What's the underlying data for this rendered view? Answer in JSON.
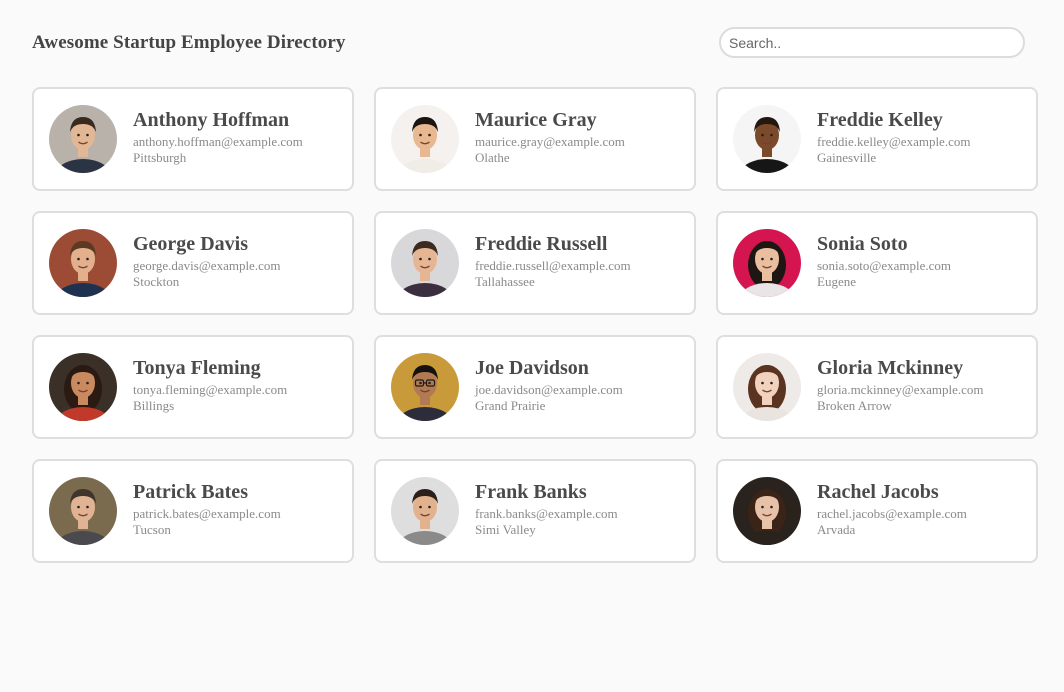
{
  "header": {
    "title": "Awesome Startup Employee Directory",
    "search_placeholder": "Search.."
  },
  "employees": [
    {
      "name": "Anthony Hoffman",
      "email": "anthony.hoffman@example.com",
      "city": "Pittsburgh",
      "photo_bg": "#b8b2ab",
      "skin": "#e2b795",
      "hair": "#3a2a1e",
      "shirt": "#2a3442"
    },
    {
      "name": "Maurice Gray",
      "email": "maurice.gray@example.com",
      "city": "Olathe",
      "photo_bg": "#f4f1ee",
      "skin": "#e8b890",
      "hair": "#1b1410",
      "shirt": "#f0ece6"
    },
    {
      "name": "Freddie Kelley",
      "email": "freddie.kelley@example.com",
      "city": "Gainesville",
      "photo_bg": "#f5f5f5",
      "skin": "#7a4a2a",
      "hair": "#231710",
      "shirt": "#161616"
    },
    {
      "name": "George Davis",
      "email": "george.davis@example.com",
      "city": "Stockton",
      "photo_bg": "#9c4b34",
      "skin": "#e3b08e",
      "hair": "#5a3a22",
      "shirt": "#1f3150"
    },
    {
      "name": "Freddie Russell",
      "email": "freddie.russell@example.com",
      "city": "Tallahassee",
      "photo_bg": "#d8d8da",
      "skin": "#e6b694",
      "hair": "#3a2a20",
      "shirt": "#3b2f3f"
    },
    {
      "name": "Sonia Soto",
      "email": "sonia.soto@example.com",
      "city": "Eugene",
      "photo_bg": "#d4154f",
      "skin": "#e9bfa0",
      "hair": "#1e1612",
      "shirt": "#e9e4e6"
    },
    {
      "name": "Tonya Fleming",
      "email": "tonya.fleming@example.com",
      "city": "Billings",
      "photo_bg": "#3a3028",
      "skin": "#c98a60",
      "hair": "#2a1a12",
      "shirt": "#c0392b"
    },
    {
      "name": "Joe Davidson",
      "email": "joe.davidson@example.com",
      "city": "Grand Prairie",
      "photo_bg": "#c99a3a",
      "skin": "#b27a52",
      "hair": "#161210",
      "shirt": "#2c2c3a"
    },
    {
      "name": "Gloria Mckinney",
      "email": "gloria.mckinney@example.com",
      "city": "Broken Arrow",
      "photo_bg": "#eeeae8",
      "skin": "#f0d2bf",
      "hair": "#5a3420",
      "shirt": "#eae4e0"
    },
    {
      "name": "Patrick Bates",
      "email": "patrick.bates@example.com",
      "city": "Tucson",
      "photo_bg": "#7a6a4e",
      "skin": "#e0b395",
      "hair": "#3f352c",
      "shirt": "#4a4a4e"
    },
    {
      "name": "Frank Banks",
      "email": "frank.banks@example.com",
      "city": "Simi Valley",
      "photo_bg": "#dedede",
      "skin": "#e2b28e",
      "hair": "#2b2019",
      "shirt": "#8a8a8a"
    },
    {
      "name": "Rachel Jacobs",
      "email": "rachel.jacobs@example.com",
      "city": "Arvada",
      "photo_bg": "#2a221c",
      "skin": "#e7c2a8",
      "hair": "#3a2418",
      "shirt": "#2a221c"
    }
  ]
}
